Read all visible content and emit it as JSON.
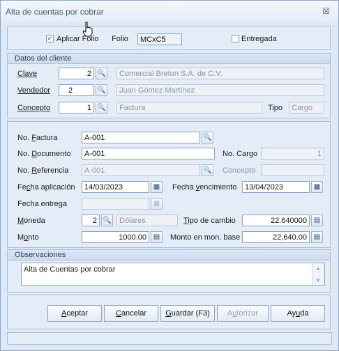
{
  "window": {
    "title": "Alta de cuentas por cobrar",
    "close_glyph": "☒"
  },
  "header": {
    "aplicar_folio_label": "Aplicar Folio",
    "aplicar_folio_checked": true,
    "folio_label": "Folio",
    "folio_value": "MCxC5",
    "entregada_label": "Entregada",
    "entregada_checked": false
  },
  "cliente": {
    "group_title": "Datos del cliente",
    "clave_label": "Clave",
    "clave_value": "2",
    "clave_name": "Comercial Breton S.A. de C.V.",
    "vendedor_label": "Vendedor",
    "vendedor_value": "2",
    "vendedor_name": "Juan Gómez Martínez",
    "concepto_label": "Concepto",
    "concepto_value": "1",
    "concepto_name": "Factura",
    "tipo_label": "Tipo",
    "tipo_value": "Cargo"
  },
  "documento": {
    "no_factura_label": "No. Factura",
    "no_factura_value": "A-001",
    "no_documento_label": "No. Documento",
    "no_documento_value": "A-001",
    "no_cargo_label": "No. Cargo",
    "no_cargo_value": "1",
    "no_referencia_label": "No. Referencia",
    "no_referencia_value": "A-001",
    "concepto_ref_label": "Concepto",
    "concepto_ref_value": "",
    "fecha_aplicacion_label": "Fecha aplicación",
    "fecha_aplicacion_value": "14/03/2023",
    "fecha_vencimiento_label": "Fecha vencimiento",
    "fecha_vencimiento_value": "13/04/2023",
    "fecha_entrega_label": "Fecha entrega",
    "fecha_entrega_value": "",
    "moneda_label": "Moneda",
    "moneda_value": "2",
    "moneda_name": "Dólares",
    "tipo_cambio_label": "Tipo de cambio",
    "tipo_cambio_value": "22.640000",
    "monto_label": "Monto",
    "monto_value": "1000.00",
    "monto_base_label": "Monto en mon. base",
    "monto_base_value": "22,640.00"
  },
  "observaciones": {
    "group_title": "Observaciones",
    "text": "Alta de Cuentas por cobrar"
  },
  "buttons": {
    "aceptar": "Aceptar",
    "cancelar": "Cancelar",
    "guardar": "Guardar (F3)",
    "autorizar": "Autorizar",
    "ayuda": "Ayuda"
  },
  "icons": {
    "search": "🔍",
    "calendar": "▦",
    "calculator": "▤",
    "check": "✓",
    "scroll_up": "▲",
    "scroll_down": "▼"
  }
}
